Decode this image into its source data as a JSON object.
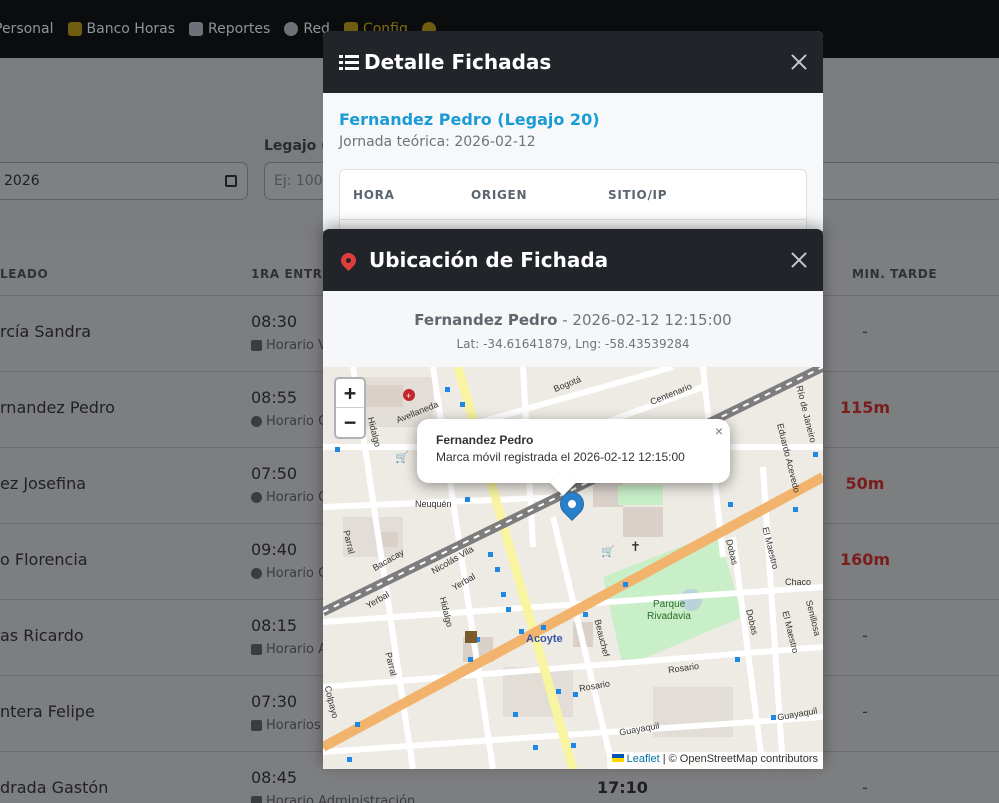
{
  "nav": {
    "items": [
      {
        "label": "Personal"
      },
      {
        "label": "Banco Horas"
      },
      {
        "label": "Reportes"
      },
      {
        "label": "Red"
      },
      {
        "label": "Config"
      }
    ]
  },
  "filters": {
    "legajo_label": "Legajo (C",
    "date_value": "2026",
    "legajo_placeholder": "Ej: 1002"
  },
  "table": {
    "headers": {
      "empleado": "LEADO",
      "entrada": "1RA ENTRAD",
      "tarde": "MIN. TARDE"
    },
    "rows": [
      {
        "name": "rcía Sandra",
        "time": "08:30",
        "schedule": "Horario V",
        "late": "-"
      },
      {
        "name": "rnandez Pedro",
        "time": "08:55",
        "schedule": "Horario C",
        "late": "115m"
      },
      {
        "name": "ez Josefina",
        "time": "07:50",
        "schedule": "Horario C",
        "late": "50m"
      },
      {
        "name": "o Florencia",
        "time": "09:40",
        "schedule": "Horario C",
        "late": "160m"
      },
      {
        "name": "as Ricardo",
        "time": "08:15",
        "schedule": "Horario A",
        "late": "-"
      },
      {
        "name": "ntera Felipe",
        "time": "07:30",
        "schedule": "Horarios",
        "late": "-"
      },
      {
        "name": "drada Gastón",
        "time": "08:45",
        "schedule": "Horario Administración",
        "late": "-",
        "exit": "17:10"
      }
    ]
  },
  "detalle_modal": {
    "title": "Detalle Fichadas",
    "employee": "Fernandez Pedro (Legajo 20)",
    "jornada": "Jornada teórica: 2026-02-12",
    "columns": [
      "HORA",
      "ORIGEN",
      "SITIO/IP"
    ]
  },
  "ubicacion_modal": {
    "title": "Ubicación de Fichada",
    "employee": "Fernandez Pedro",
    "separator": " - ",
    "datetime": "2026-02-12 12:15:00",
    "coords": "Lat: -34.61641879, Lng: -58.43539284",
    "map": {
      "zoom_in": "+",
      "zoom_out": "−",
      "popup_title": "Fernandez Pedro",
      "popup_text": "Marca móvil registrada el 2026-02-12 12:15:00",
      "popup_close": "×",
      "attribution_link": "Leaflet",
      "attribution_text": " | © OpenStreetMap contributors",
      "labels": {
        "parque": "Parque",
        "rivadavia": "Rivadavia",
        "acoyte": "Acoyte",
        "rosario": "Rosario",
        "yerbal": "Yerbal",
        "neuquen": "Neuquén",
        "avellaneda": "Avellaneda",
        "bogota": "Bogotá",
        "centenario": "Centenario",
        "hidalgo": "Hidalgo",
        "parral": "Parral",
        "bacacay": "Bacacay",
        "nicolas_vila": "Nicolás Vila",
        "guayaquil": "Guayaquil",
        "beauchef": "Beauchef",
        "chaco": "Chaco",
        "dobas": "Dobas",
        "el_maestro": "El Maestro",
        "eduardo_acevedo": "Eduardo Acevedo",
        "colpayo": "Colpayo",
        "rio_de_janeiro": "Río de Janeiro",
        "senillosa": "Senillosa"
      }
    }
  },
  "colors": {
    "accent_blue": "#1a9bd6",
    "header_dark": "#212529",
    "late_red": "#7a1d1d",
    "marker_blue": "#2a81cb"
  }
}
